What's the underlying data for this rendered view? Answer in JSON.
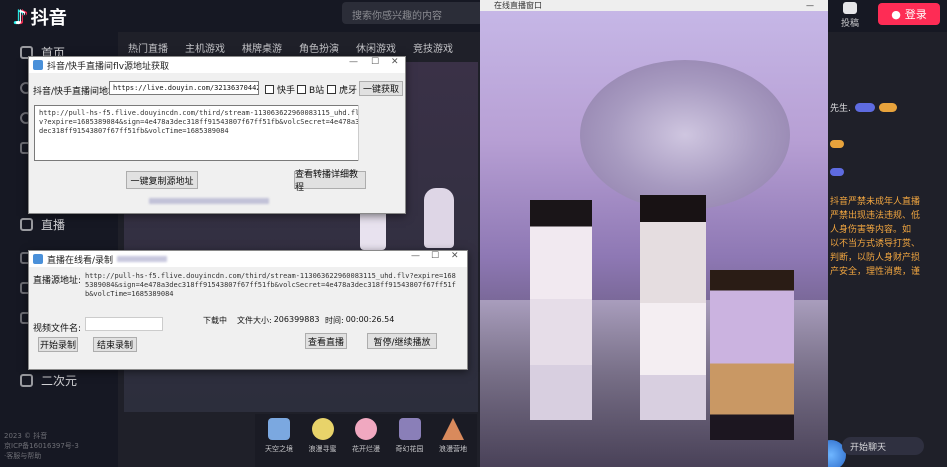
{
  "app": {
    "name": "抖音"
  },
  "search": {
    "placeholder": "搜索你感兴趣的内容"
  },
  "topbar": {
    "icon_label": "投稿",
    "login_label": "登录"
  },
  "sidebar": {
    "items": [
      {
        "label": "首页"
      },
      {
        "label": "直播"
      },
      {
        "label": "二次元"
      }
    ],
    "footer": [
      "2023 © 抖音",
      "京ICP备16016397号-3",
      "·客服与帮助"
    ]
  },
  "categories": [
    "热门直播",
    "主机游戏",
    "棋牌桌游",
    "角色扮演",
    "休闲游戏",
    "竞技游戏"
  ],
  "chat": {
    "user": "先生.",
    "notice": "抖音严禁未成年人直播\n严禁出现违法违规、低\n人身伤害等内容。如\n以不当方式诱导打赏、\n判断，以防人身财产损\n产安全，理性消费，谨",
    "start_chat": "开始聊天"
  },
  "gifts": [
    {
      "label": "天空之境"
    },
    {
      "label": "浪漫寻蜜"
    },
    {
      "label": "花开烂漫"
    },
    {
      "label": "奇幻花园"
    },
    {
      "label": "浪漫营地"
    }
  ],
  "video_window": {
    "title": "在线直播窗口"
  },
  "dialog1": {
    "title": "抖音/快手直播间flv源地址获取",
    "url_label": "抖音/快手直播间地址:",
    "url_value": "https://live.douyin.com/32136370442",
    "cb_kuaishou": "快手",
    "cb_bilibili": "B站",
    "cb_huya": "虎牙",
    "fetch_button": "一键获取",
    "result_text": "http://pull-hs-f5.flive.douyincdn.com/third/stream-113063622960083115_uhd.flv?expire=1685389084&sign=4e478a3dec318ff91543807f67ff51fb&volcSecret=4e478a3dec318ff91543807f67ff51fb&volcTime=1685389084",
    "copy_button": "一键复制源地址",
    "tutorial_button": "查看转播详细教程"
  },
  "dialog2": {
    "title": "直播在线看/录制",
    "src_label": "直播源地址:",
    "src_value": "http://pull-hs-f5.flive.douyincdn.com/third/stream-113063622960083115_uhd.flv?expire=1685389084&sign=4e478a3dec318ff91543807f67ff51fb&volcSecret=4e478a3dec318ff91543807f67ff51fb&volcTime=1685389084",
    "filename_label": "视频文件名:",
    "filename_value": "",
    "status": "下载中",
    "size_label": "文件大小:",
    "size_value": "206399883",
    "time_label": "时间:",
    "time_value": "00:00:26.54",
    "start_button": "开始录制",
    "stop_button": "结束录制",
    "view_button": "查看直播",
    "pause_button": "暂停/继续播放"
  },
  "colors": {
    "accent": "#fe2c55",
    "bg": "#161823",
    "notice": "#f2a640"
  }
}
